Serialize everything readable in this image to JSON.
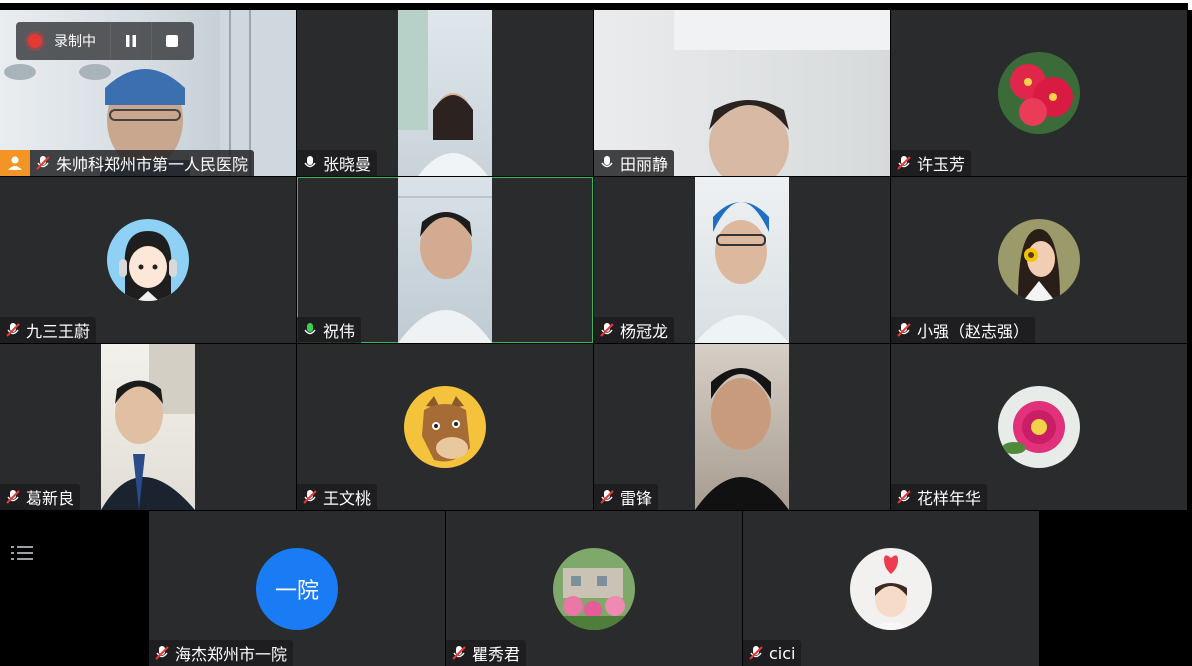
{
  "recording": {
    "text": "录制中"
  },
  "participants": [
    {
      "name": "朱帅科郑州市第一人民医院",
      "mic": "muted",
      "host": true,
      "type": "video"
    },
    {
      "name": "张晓曼",
      "mic": "on",
      "type": "video"
    },
    {
      "name": "田丽静",
      "mic": "on",
      "type": "video"
    },
    {
      "name": "许玉芳",
      "mic": "muted",
      "type": "avatar",
      "avatar": "red-flower"
    },
    {
      "name": "九三王蔚",
      "mic": "muted",
      "type": "avatar",
      "avatar": "cartoon-girl-headset"
    },
    {
      "name": "祝伟",
      "mic": "speaking",
      "type": "video",
      "active": true
    },
    {
      "name": "杨冠龙",
      "mic": "muted",
      "type": "video"
    },
    {
      "name": "小强（赵志强）",
      "mic": "muted",
      "type": "avatar",
      "avatar": "woman-with-flower"
    },
    {
      "name": "葛新良",
      "mic": "muted",
      "type": "video"
    },
    {
      "name": "王文桃",
      "mic": "muted",
      "type": "avatar",
      "avatar": "cartoon-horse"
    },
    {
      "name": "雷锋",
      "mic": "muted",
      "type": "video"
    },
    {
      "name": "花样年华",
      "mic": "muted",
      "type": "avatar",
      "avatar": "pink-peony"
    },
    {
      "name": "海杰郑州市一院",
      "mic": "muted",
      "type": "text-avatar",
      "avatar_text": "一院"
    },
    {
      "name": "瞿秀君",
      "mic": "muted",
      "type": "avatar",
      "avatar": "garden-photo"
    },
    {
      "name": "cici",
      "mic": "muted",
      "type": "avatar",
      "avatar": "child-photo"
    }
  ],
  "colors": {
    "tile_bg": "#2a2b2d",
    "active_border": "#2fbf5a",
    "rec_red": "#e53935",
    "host_orange": "#f39426",
    "text_avatar_blue": "#1a7cf5"
  }
}
